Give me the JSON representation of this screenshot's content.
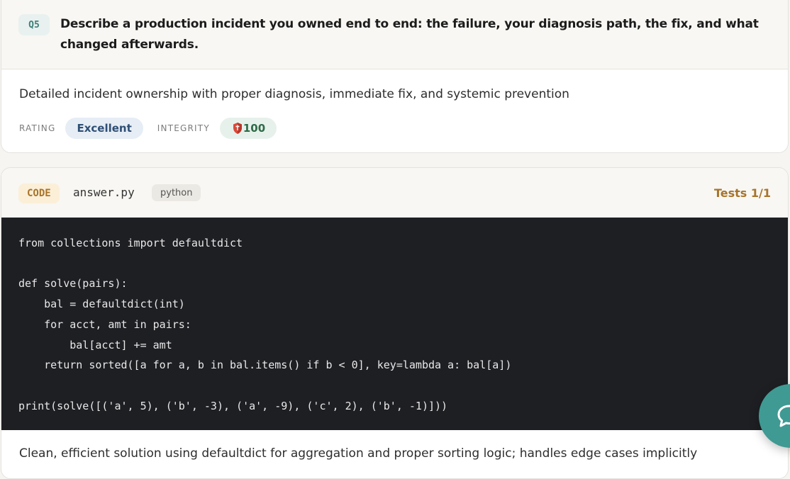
{
  "question": {
    "number": "Q5",
    "title": "Describe a production incident you owned end to end: the failure, your diagnosis path, the fix, and what changed afterwards.",
    "summary": "Detailed incident ownership with proper diagnosis, immediate fix, and systemic prevention",
    "rating_label": "RATING",
    "rating_value": "Excellent",
    "integrity_label": "INTEGRITY",
    "integrity_value": "100",
    "integrity_icon": "shield-icon"
  },
  "code": {
    "tag": "CODE",
    "filename": "answer.py",
    "language": "python",
    "tests": "Tests 1/1",
    "source": "from collections import defaultdict\n\ndef solve(pairs):\n    bal = defaultdict(int)\n    for acct, amt in pairs:\n        bal[acct] += amt\n    return sorted([a for a, b in bal.items() if b < 0], key=lambda a: bal[a])\n\nprint(solve([('a', 5), ('b', -3), ('a', -9), ('c', 2), ('b', -1)]))",
    "feedback": "Clean, efficient solution using defaultdict for aggregation and proper sorting logic; handles edge cases implicitly"
  },
  "chat": {
    "icon": "chat-icon"
  },
  "colors": {
    "accent_teal": "#3f9a93",
    "code_accent": "#a8742a",
    "rating_text": "#2f4f75",
    "integrity_text": "#2e6b47",
    "code_bg": "#1e1f23"
  }
}
